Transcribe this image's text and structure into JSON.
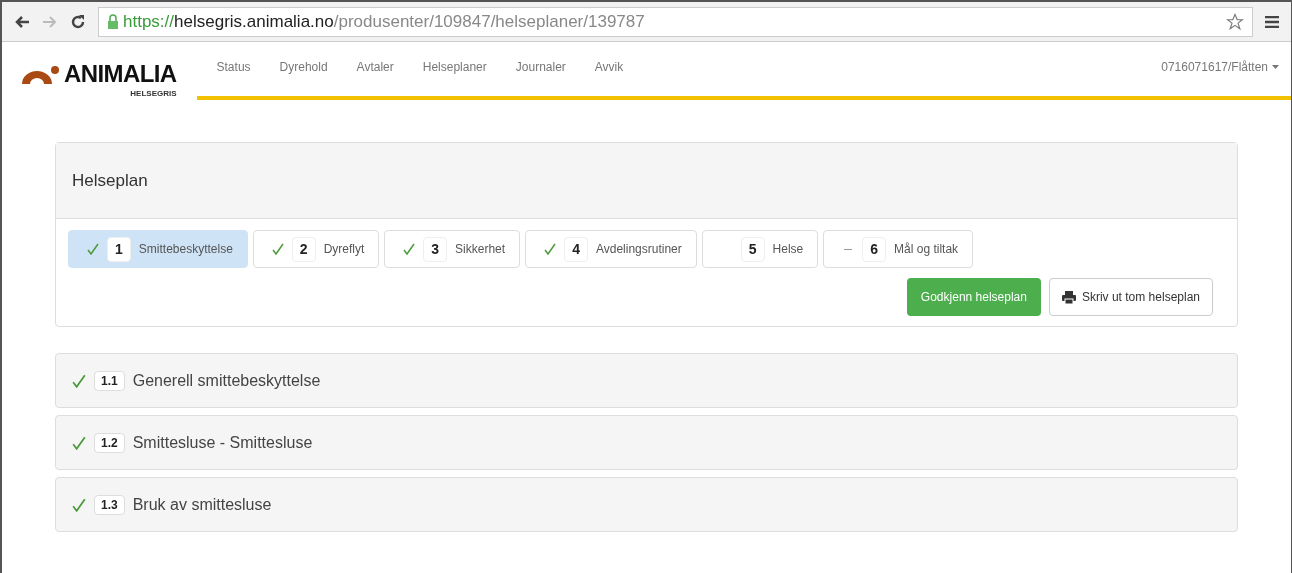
{
  "browser": {
    "url": {
      "scheme": "https://",
      "host": "helsegris.animalia.no",
      "path": "/produsenter/109847/helseplaner/139787"
    }
  },
  "logo": {
    "name": "ANIMALIA",
    "sub": "HELSEGRIS"
  },
  "nav": [
    {
      "label": "Status"
    },
    {
      "label": "Dyrehold"
    },
    {
      "label": "Avtaler"
    },
    {
      "label": "Helseplaner"
    },
    {
      "label": "Journaler"
    },
    {
      "label": "Avvik"
    }
  ],
  "user_menu": "0716071617/Flåtten",
  "panel": {
    "title": "Helseplan",
    "steps": [
      {
        "number": "1",
        "label": "Smittebeskyttelse",
        "kind": "done",
        "selected": true
      },
      {
        "number": "2",
        "label": "Dyreflyt",
        "kind": "done",
        "selected": false
      },
      {
        "number": "3",
        "label": "Sikkerhet",
        "kind": "done",
        "selected": false
      },
      {
        "number": "4",
        "label": "Avdelingsrutiner",
        "kind": "done",
        "selected": false
      },
      {
        "number": "5",
        "label": "Helse",
        "kind": "open",
        "selected": false
      },
      {
        "number": "6",
        "label": "Mål og tiltak",
        "kind": "partial",
        "selected": false
      }
    ],
    "approve_button": "Godkjenn helseplan",
    "print_button": "Skriv ut tom helseplan"
  },
  "sections": [
    {
      "number": "1.1",
      "title": "Generell smittebeskyttelse",
      "checked": true
    },
    {
      "number": "1.2",
      "title": "Smittesluse - Smittesluse",
      "checked": true
    },
    {
      "number": "1.3",
      "title": "Bruk av smittesluse",
      "checked": true
    }
  ]
}
